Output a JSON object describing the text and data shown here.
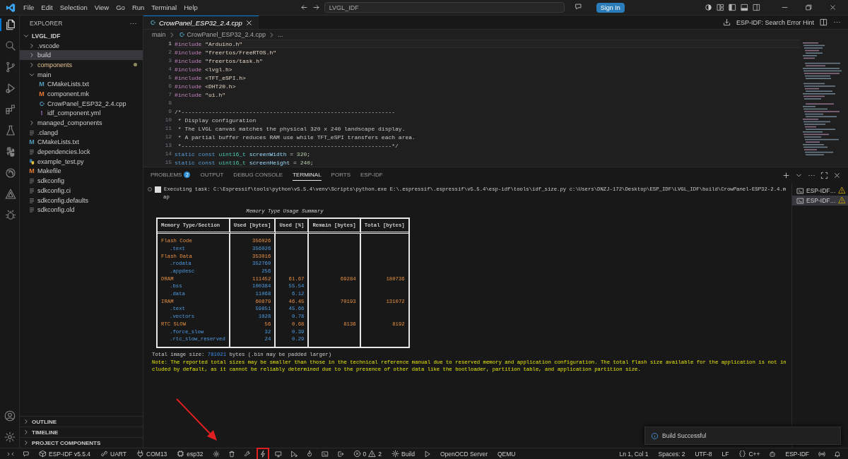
{
  "title_bar": {
    "menu": [
      "File",
      "Edit",
      "Selection",
      "View",
      "Go",
      "Run",
      "Terminal",
      "Help"
    ],
    "command_center": "LVGL_IDF",
    "sign_in": "Sign In"
  },
  "activity_bar": [
    {
      "selected": true
    },
    {
      "selected": false
    },
    {
      "selected": false
    },
    {
      "selected": false
    },
    {
      "selected": false
    },
    {
      "selected": false
    },
    {
      "selected": false
    },
    {
      "selected": false
    },
    {
      "selected": false
    },
    {
      "selected": false
    }
  ],
  "sidebar": {
    "title": "EXPLORER",
    "root": {
      "label": "LVGL_IDF",
      "expanded": true,
      "children": [
        {
          "label": ".vscode",
          "kind": "folder",
          "expanded": false,
          "selected": false,
          "modified": false
        },
        {
          "label": "build",
          "kind": "folder",
          "expanded": false,
          "selected": true,
          "modified": false
        },
        {
          "label": "components",
          "kind": "folder",
          "expanded": false,
          "selected": false,
          "modified": true
        },
        {
          "label": "main",
          "kind": "folder",
          "expanded": true,
          "selected": false,
          "modified": false,
          "children": [
            {
              "label": "CMakeLists.txt",
              "kind": "cmake",
              "icon_text": "M",
              "selected": false,
              "modified": false
            },
            {
              "label": "component.mk",
              "kind": "make",
              "icon_text": "M",
              "selected": false,
              "modified": false
            },
            {
              "label": "CrowPanel_ESP32_2.4.cpp",
              "kind": "cpp",
              "selected": false,
              "modified": false
            },
            {
              "label": "idf_component.yml",
              "kind": "yaml",
              "icon_text": "!",
              "selected": false,
              "modified": false
            }
          ]
        },
        {
          "label": "managed_components",
          "kind": "folder",
          "expanded": false,
          "selected": false,
          "modified": false
        },
        {
          "label": ".clangd",
          "kind": "config",
          "selected": false,
          "modified": false
        },
        {
          "label": "CMakeLists.txt",
          "kind": "cmake",
          "icon_text": "M",
          "selected": false,
          "modified": false
        },
        {
          "label": "dependencies.lock",
          "kind": "config",
          "selected": false,
          "modified": false
        },
        {
          "label": "example_test.py",
          "kind": "python",
          "selected": false,
          "modified": false
        },
        {
          "label": "Makefile",
          "kind": "make",
          "icon_text": "M",
          "selected": false,
          "modified": false
        },
        {
          "label": "sdkconfig",
          "kind": "config",
          "selected": false,
          "modified": false
        },
        {
          "label": "sdkconfig.ci",
          "kind": "config",
          "selected": false,
          "modified": false
        },
        {
          "label": "sdkconfig.defaults",
          "kind": "config",
          "selected": false,
          "modified": false
        },
        {
          "label": "sdkconfig.old",
          "kind": "config",
          "selected": false,
          "modified": false
        }
      ]
    },
    "sections": [
      {
        "label": "OUTLINE",
        "expanded": false
      },
      {
        "label": "TIMELINE",
        "expanded": false
      },
      {
        "label": "PROJECT COMPONENTS",
        "expanded": false
      }
    ]
  },
  "editor": {
    "tabs": [
      {
        "label": "CrowPanel_ESP32_2.4.cpp",
        "selected": true,
        "preview": true
      }
    ],
    "action": "ESP-IDF: Search Error Hint",
    "breadcrumbs": [
      {
        "label": "main",
        "kind": "folder"
      },
      {
        "label": "CrowPanel_ESP32_2.4.cpp",
        "kind": "cpp"
      },
      {
        "label": "...",
        "kind": "more"
      }
    ],
    "lines": [
      {
        "number": "1",
        "current": true,
        "tokens": [
          {
            "text": "#include ",
            "kind": "dir"
          },
          {
            "text": "\"Arduino.h\"",
            "kind": "str"
          }
        ]
      },
      {
        "number": "2",
        "current": false,
        "tokens": [
          {
            "text": "#include ",
            "kind": "dir"
          },
          {
            "text": "\"freertos/FreeRTOS.h\"",
            "kind": "str"
          }
        ]
      },
      {
        "number": "3",
        "current": false,
        "tokens": [
          {
            "text": "#include ",
            "kind": "dir"
          },
          {
            "text": "\"freertos/task.h\"",
            "kind": "str"
          }
        ]
      },
      {
        "number": "4",
        "current": false,
        "tokens": [
          {
            "text": "#include ",
            "kind": "dir"
          },
          {
            "text": "<lvgl.h>",
            "kind": "str"
          }
        ]
      },
      {
        "number": "5",
        "current": false,
        "tokens": [
          {
            "text": "#include ",
            "kind": "dir"
          },
          {
            "text": "<TFT_eSPI.h>",
            "kind": "str"
          }
        ]
      },
      {
        "number": "6",
        "current": false,
        "tokens": [
          {
            "text": "#include ",
            "kind": "dir"
          },
          {
            "text": "<DHT20.h>",
            "kind": "str"
          }
        ]
      },
      {
        "number": "7",
        "current": false,
        "tokens": [
          {
            "text": "#include ",
            "kind": "dir"
          },
          {
            "text": "\"ui.h\"",
            "kind": "str"
          }
        ]
      },
      {
        "number": "8",
        "current": false
      },
      {
        "number": "9",
        "current": false,
        "tokens": [
          {
            "text": "/*---------------------------------------------------------------",
            "kind": "cm"
          }
        ]
      },
      {
        "number": "10",
        "current": false,
        "tokens": [
          {
            "text": " * Display configuration",
            "kind": "cm"
          }
        ]
      },
      {
        "number": "11",
        "current": false,
        "tokens": [
          {
            "text": " * The LVGL canvas matches the physical 320 x 240 landscape display.",
            "kind": "cm"
          }
        ]
      },
      {
        "number": "12",
        "current": false,
        "tokens": [
          {
            "text": " * A partial buffer reduces RAM use while TFT_eSPI transfers each area.",
            "kind": "cm"
          }
        ]
      },
      {
        "number": "13",
        "current": false,
        "tokens": [
          {
            "text": " *--------------------------------------------------------------*/",
            "kind": "cm"
          }
        ]
      },
      {
        "number": "14",
        "current": false,
        "tokens": [
          {
            "text": "static ",
            "kind": "kw"
          },
          {
            "text": "const ",
            "kind": "kw"
          },
          {
            "text": "uint16_t ",
            "kind": "type"
          },
          {
            "text": "screenWidth",
            "kind": "id"
          },
          {
            "text": " = ",
            "kind": "op"
          },
          {
            "text": "320",
            "kind": "num"
          },
          {
            "text": ";",
            "kind": "op"
          }
        ]
      },
      {
        "number": "15",
        "current": false,
        "tokens": [
          {
            "text": "static ",
            "kind": "kw"
          },
          {
            "text": "const ",
            "kind": "kw"
          },
          {
            "text": "uint16_t ",
            "kind": "type"
          },
          {
            "text": "screenHeight",
            "kind": "id"
          },
          {
            "text": " = ",
            "kind": "op"
          },
          {
            "text": "240",
            "kind": "num"
          },
          {
            "text": ";",
            "kind": "op"
          }
        ]
      }
    ]
  },
  "panel": {
    "tabs": [
      {
        "label": "PROBLEMS",
        "badge": "2",
        "selected": false
      },
      {
        "label": "OUTPUT",
        "selected": false
      },
      {
        "label": "DEBUG CONSOLE",
        "selected": false
      },
      {
        "label": "TERMINAL",
        "selected": true
      },
      {
        "label": "PORTS",
        "selected": false
      },
      {
        "label": "ESP-IDF",
        "selected": false
      }
    ],
    "terminal": {
      "task_lines": [
        "Executing task: C:\\Espressif\\tools\\python\\v5.5.4\\venv\\Scripts\\python.exe E:\\.espressif\\.espressif\\v5.5.4\\esp-idf\\tools\\idf_size.py c:\\Users\\DNZJ-172\\Desktop\\ESP_IDF\\LVGL_IDF\\build\\CrowPanel-ESP32-2.4.m",
        "ap"
      ],
      "caption": "Memory Type Usage Summary",
      "columns": [
        "Memory Type/Section",
        "Used [bytes]",
        "Used [%]",
        "Remain [bytes]",
        "Total [bytes]"
      ],
      "rows": [
        {
          "kind": "category",
          "name": "Flash Code",
          "used_bytes": "356026"
        },
        {
          "kind": "section",
          "name": ".text",
          "used_bytes": "356026"
        },
        {
          "kind": "category",
          "name": "Flash Data",
          "used_bytes": "353016"
        },
        {
          "kind": "section",
          "name": ".rodata",
          "used_bytes": "352760"
        },
        {
          "kind": "section",
          "name": ".appdesc",
          "used_bytes": "256"
        },
        {
          "kind": "category",
          "name": "DRAM",
          "used_bytes": "111452",
          "used_pct": "61.67",
          "remain": "69284",
          "total": "180736"
        },
        {
          "kind": "section",
          "name": ".bss",
          "used_bytes": "100384",
          "used_pct": "55.54"
        },
        {
          "kind": "section",
          "name": ".data",
          "used_bytes": "11068",
          "used_pct": "6.12"
        },
        {
          "kind": "category",
          "name": "IRAM",
          "used_bytes": "60879",
          "used_pct": "46.45",
          "remain": "70193",
          "total": "131072"
        },
        {
          "kind": "section",
          "name": ".text",
          "used_bytes": "59851",
          "used_pct": "45.66"
        },
        {
          "kind": "section",
          "name": ".vectors",
          "used_bytes": "1028",
          "used_pct": "0.78"
        },
        {
          "kind": "category",
          "name": "RTC SLOW",
          "used_bytes": "56",
          "used_pct": "0.68",
          "remain": "8136",
          "total": "8192"
        },
        {
          "kind": "section",
          "name": ".force_slow",
          "used_bytes": "32",
          "used_pct": "0.39"
        },
        {
          "kind": "section",
          "name": ".rtc_slow_reserved",
          "used_bytes": "24",
          "used_pct": "0.29"
        }
      ],
      "total": {
        "label": "Total image size:",
        "value": "781021",
        "suffix": "bytes (.bin may be padded larger)"
      },
      "note_lines": [
        "Note: The reported total sizes may be smaller than those in the technical reference manual due to reserved memory and application configuration. The total flash size available for the application is not in",
        "cluded by default, as it cannot be reliably determined due to the presence of other data like the bootloader, partition table, and application partition size."
      ]
    },
    "terminals": [
      {
        "label": "ESP-IDF…",
        "selected": false,
        "warning": true
      },
      {
        "label": "ESP-IDF…",
        "selected": true,
        "warning": true
      }
    ]
  },
  "notification": {
    "message": "Build Successful"
  },
  "status_bar": {
    "left": [
      {
        "kind": "icon",
        "highlighted": false
      },
      {
        "kind": "icon",
        "highlighted": false
      },
      {
        "kind": "labeled",
        "text": "ESP-IDF v5.5.4",
        "highlighted": false
      },
      {
        "kind": "labeled",
        "text": "UART",
        "highlighted": false
      },
      {
        "kind": "labeled",
        "text": "COM13",
        "highlighted": false
      },
      {
        "kind": "labeled",
        "text": "esp32",
        "highlighted": false
      },
      {
        "kind": "icon",
        "highlighted": false
      },
      {
        "kind": "icon",
        "highlighted": false
      },
      {
        "kind": "icon",
        "highlighted": false
      },
      {
        "kind": "icon",
        "highlighted": true
      },
      {
        "kind": "icon",
        "highlighted": false
      },
      {
        "kind": "icon",
        "highlighted": false
      },
      {
        "kind": "icon",
        "highlighted": false
      },
      {
        "kind": "icon",
        "highlighted": false
      },
      {
        "kind": "icon",
        "highlighted": false
      },
      {
        "kind": "problems",
        "errors": "0",
        "warnings": "2",
        "highlighted": false
      },
      {
        "kind": "labeled",
        "text": "Build",
        "highlighted": false
      },
      {
        "kind": "icon",
        "highlighted": false
      },
      {
        "kind": "text",
        "text": "OpenOCD Server",
        "highlighted": false
      },
      {
        "kind": "text",
        "text": "QEMU",
        "highlighted": false
      }
    ],
    "right": [
      {
        "kind": "text",
        "text": "Ln 1, Col 1",
        "highlighted": false
      },
      {
        "kind": "text",
        "text": "Spaces: 2",
        "highlighted": false
      },
      {
        "kind": "text",
        "text": "UTF-8",
        "highlighted": false
      },
      {
        "kind": "text",
        "text": "LF",
        "highlighted": false
      },
      {
        "kind": "labeled",
        "text": "C++",
        "highlighted": false
      },
      {
        "kind": "icon",
        "highlighted": false
      },
      {
        "kind": "text",
        "text": "ESP-IDF",
        "highlighted": false
      },
      {
        "kind": "icon",
        "highlighted": false
      },
      {
        "kind": "icon",
        "highlighted": false
      }
    ]
  }
}
